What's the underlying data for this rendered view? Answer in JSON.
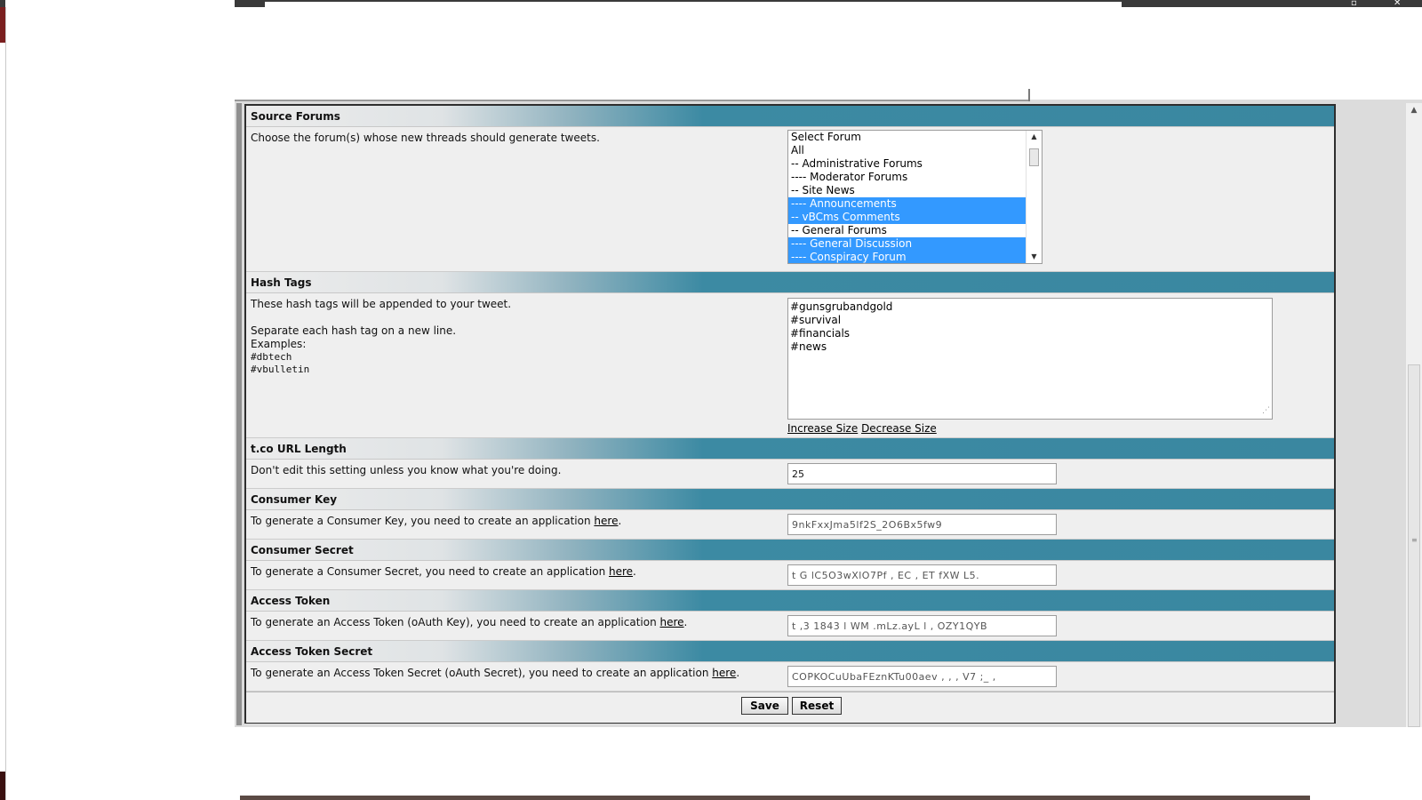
{
  "window": {
    "minimize_glyph": "▫",
    "close_glyph": "✕"
  },
  "sections": {
    "source_forums": {
      "title": "Source Forums",
      "description": "Choose the forum(s) whose new threads should generate tweets.",
      "options": [
        {
          "label": "Select Forum",
          "selected": false
        },
        {
          "label": "All",
          "selected": false
        },
        {
          "label": "-- Administrative Forums",
          "selected": false
        },
        {
          "label": "---- Moderator Forums",
          "selected": false
        },
        {
          "label": "-- Site News",
          "selected": false
        },
        {
          "label": "---- Announcements",
          "selected": true
        },
        {
          "label": "-- vBCms Comments",
          "selected": true
        },
        {
          "label": "-- General Forums",
          "selected": false
        },
        {
          "label": "---- General Discussion",
          "selected": true
        },
        {
          "label": "---- Conspiracy Forum",
          "selected": true
        }
      ]
    },
    "hash_tags": {
      "title": "Hash Tags",
      "line1": "These hash tags will be appended to your tweet.",
      "line2": "Separate each hash tag on a new line.",
      "line3": "Examples:",
      "example1": "#dbtech",
      "example2": "#vbulletin",
      "tags": [
        "#gunsgrubandgold",
        "#survival",
        "#financials",
        "#news"
      ],
      "increase_label": "Increase Size",
      "decrease_label": "Decrease Size"
    },
    "tco_length": {
      "title": "t.co URL Length",
      "description": "Don't edit this setting unless you know what you're doing.",
      "value": "25"
    },
    "consumer_key": {
      "title": "Consumer Key",
      "description_prefix": "To generate a Consumer Key, you need to create an application ",
      "link": "here",
      "suffix": ".",
      "value": "9nkFxxJma5lf2S_2O6Bx5fw9"
    },
    "consumer_secret": {
      "title": "Consumer Secret",
      "description_prefix": "To generate a Consumer Secret, you need to create an application ",
      "link": "here",
      "suffix": ".",
      "value": "t  G   lC5O3wXlO7Pf   , EC    ,   ET  fXW    L5."
    },
    "access_token": {
      "title": "Access Token",
      "description_prefix": "To generate an Access Token (oAuth Key), you need to create an application ",
      "link": "here",
      "suffix": ".",
      "value": "t  ,3      1843  l         WM    .mLz.ayL  l  ,  OZY1QYB"
    },
    "access_token_secret": {
      "title": "Access Token Secret",
      "description_prefix": "To generate an Access Token Secret (oAuth Secret), you need to create an application ",
      "link": "here",
      "suffix": ".",
      "value": "COPKOCuUbaFEznKTu00aev  , ,   ,      V7 ;_ ,"
    }
  },
  "buttons": {
    "save": "Save",
    "reset": "Reset"
  }
}
